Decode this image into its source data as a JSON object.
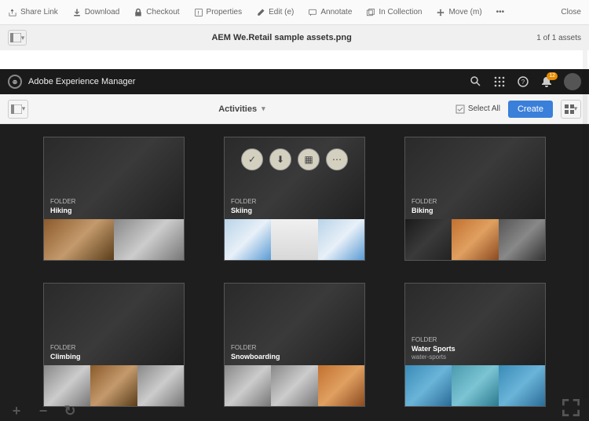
{
  "outerToolbar": {
    "shareLink": "Share Link",
    "download": "Download",
    "checkout": "Checkout",
    "properties": "Properties",
    "edit": "Edit (e)",
    "annotate": "Annotate",
    "inCollection": "In Collection",
    "move": "Move (m)",
    "more": "•••",
    "close": "Close"
  },
  "titleBar": {
    "title": "AEM We.Retail sample assets.png",
    "count": "1 of 1 assets"
  },
  "aemBar": {
    "product": "Adobe Experience Manager",
    "notifications": "12"
  },
  "subToolbar": {
    "breadcrumb": "Activities",
    "selectAll": "Select All",
    "create": "Create"
  },
  "cards": [
    {
      "type": "FOLDER",
      "name": "Hiking"
    },
    {
      "type": "FOLDER",
      "name": "Skiing"
    },
    {
      "type": "FOLDER",
      "name": "Biking"
    },
    {
      "type": "FOLDER",
      "name": "Climbing"
    },
    {
      "type": "FOLDER",
      "name": "Snowboarding"
    },
    {
      "type": "FOLDER",
      "name": "Water Sports",
      "sub": "water-sports"
    }
  ]
}
